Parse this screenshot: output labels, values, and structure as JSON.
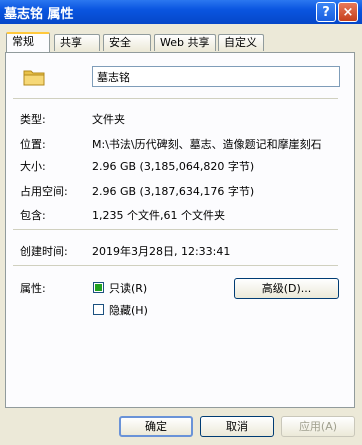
{
  "window": {
    "title": "墓志铭 属性",
    "help_label": "?",
    "close_label": "×"
  },
  "tabs": [
    {
      "label": "常规"
    },
    {
      "label": "共享"
    },
    {
      "label": "安全"
    },
    {
      "label": "Web 共享"
    },
    {
      "label": "自定义"
    }
  ],
  "general": {
    "icon": "folder-icon",
    "name": "墓志铭",
    "fields": {
      "type": {
        "label": "类型:",
        "value": "文件夹"
      },
      "location": {
        "label": "位置:",
        "value": "M:\\书法\\历代碑刻、墓志、造像题记和摩崖刻石"
      },
      "size": {
        "label": "大小:",
        "value": "2.96 GB (3,185,064,820 字节)"
      },
      "size_on_disk": {
        "label": "占用空间:",
        "value": "2.96 GB (3,187,634,176 字节)"
      },
      "contains": {
        "label": "包含:",
        "value": "1,235 个文件,61 个文件夹"
      },
      "created": {
        "label": "创建时间:",
        "value": "2019年3月28日, 12:33:41"
      }
    },
    "attributes": {
      "label": "属性:",
      "readonly": {
        "label": "只读(R)",
        "checked": true
      },
      "hidden": {
        "label": "隐藏(H)",
        "checked": false
      },
      "advanced_button": "高级(D)..."
    }
  },
  "footer": {
    "ok": "确定",
    "cancel": "取消",
    "apply": "应用(A)"
  }
}
